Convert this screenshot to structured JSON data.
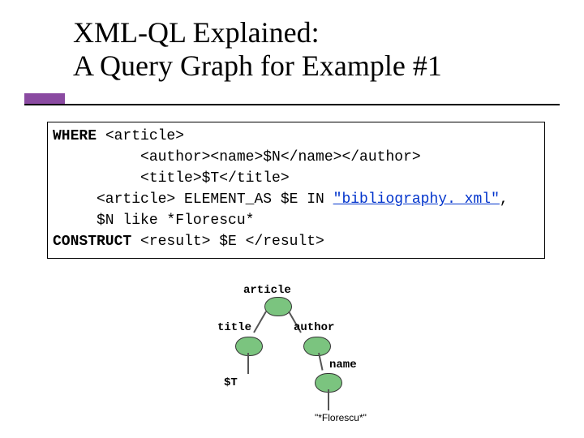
{
  "title_line1": "XML-QL Explained:",
  "title_line2": "A Query Graph for Example #1",
  "code": {
    "kw_where": "WHERE",
    "l1": " <article>",
    "l2": "          <author><name>$N</name></author>",
    "l3": "          <title>$T</title>",
    "l4_a": "     <article> ELEMENT_AS $E IN ",
    "l4_link": "\"bibliography. xml\"",
    "l4_b": ",",
    "l5": "     $N like *Florescu*",
    "kw_construct": "CONSTRUCT",
    "l6": " <result> $E </result>"
  },
  "graph": {
    "article": "article",
    "title": "title",
    "author": "author",
    "name": "name",
    "tvar": "$T",
    "leaf": "\"*Florescu*\""
  }
}
